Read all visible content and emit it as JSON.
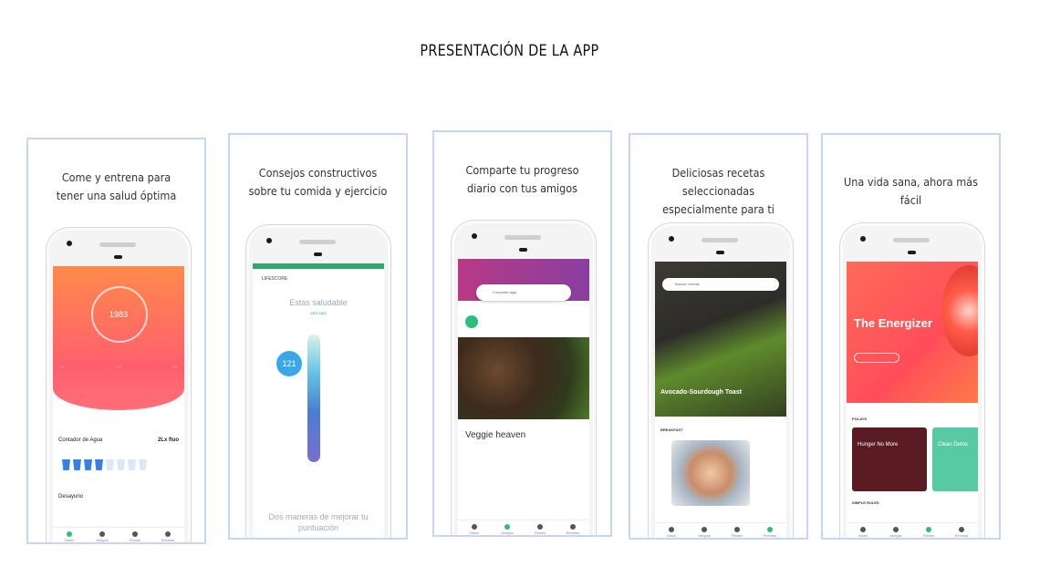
{
  "page_title": "PRESENTACIÓN DE LA APP",
  "panels": [
    {
      "caption_line1": "Come y entrena para",
      "caption_line2": "tener una salud óptima",
      "screen": {
        "calories": "1983",
        "water_label": "Contador de Agua",
        "water_value": "2Lx fluo",
        "meal_label": "Desayuno",
        "tabs": [
          "Diario",
          "Amigos",
          "Planes",
          "Recetas"
        ],
        "active_tab": 0
      }
    },
    {
      "caption_line1": "Consejos constructivos",
      "caption_line2": "sobre tu comida y ejercicio",
      "screen": {
        "header": "LIFESCORE",
        "status": "Estás saludable",
        "link": "VER MÁS",
        "score": "121",
        "footer_line1": "Dos maneras de mejorar tu",
        "footer_line2": "puntuación"
      }
    },
    {
      "caption_line1": "Comparte tu progreso",
      "caption_line2": "diario con tus amigos",
      "screen": {
        "search_placeholder": "Comparte algo",
        "post_title": "Veggie heaven",
        "tabs": [
          "Diario",
          "Amigos",
          "Planes",
          "Recetas"
        ],
        "active_tab": 1
      }
    },
    {
      "caption_line1": "Deliciosas recetas seleccionadas",
      "caption_line2": "especialmente para ti",
      "screen": {
        "search_placeholder": "Buscar recetas",
        "recipe_title": "Avocado-Sourdough Toast",
        "section_label": "BREAKFAST",
        "tabs": [
          "Diario",
          "Amigos",
          "Planes",
          "Recetas"
        ],
        "active_tab": 3
      }
    },
    {
      "caption_line1": "Una vida sana, ahora más fácil",
      "caption_line2": "",
      "screen": {
        "hero_title": "The Energizer",
        "section_label": "POLAYS",
        "card1_title": "Hunger No More",
        "card2_title": "Clean Detox",
        "section2_label": "SIMPLE RULES",
        "tabs": [
          "Diario",
          "Amigos",
          "Planes",
          "Recetas"
        ],
        "active_tab": 2
      }
    }
  ]
}
